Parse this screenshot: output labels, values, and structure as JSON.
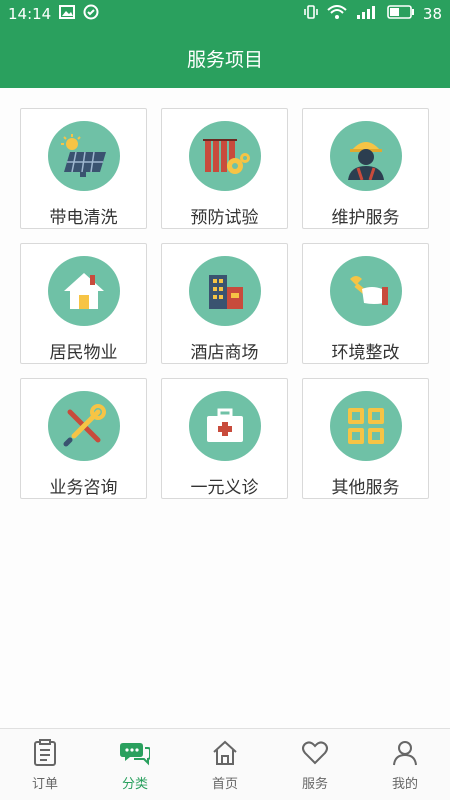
{
  "status_bar": {
    "time": "14:14",
    "battery": "38"
  },
  "header": {
    "title": "服务项目"
  },
  "services": [
    {
      "label": "带电清洗",
      "icon": "solar-panel-icon"
    },
    {
      "label": "预防试验",
      "icon": "factory-gear-icon"
    },
    {
      "label": "维护服务",
      "icon": "worker-icon"
    },
    {
      "label": "居民物业",
      "icon": "house-icon"
    },
    {
      "label": "酒店商场",
      "icon": "buildings-icon"
    },
    {
      "label": "环境整改",
      "icon": "hand-wrench-icon"
    },
    {
      "label": "业务咨询",
      "icon": "tools-icon"
    },
    {
      "label": "一元义诊",
      "icon": "medical-kit-icon"
    },
    {
      "label": "其他服务",
      "icon": "grid-icon"
    }
  ],
  "tabbar": [
    {
      "label": "订单",
      "icon": "order-icon"
    },
    {
      "label": "分类",
      "icon": "category-chat-icon",
      "active": true
    },
    {
      "label": "首页",
      "icon": "home-icon"
    },
    {
      "label": "服务",
      "icon": "heart-icon"
    },
    {
      "label": "我的",
      "icon": "user-icon"
    }
  ],
  "colors": {
    "primary": "#2aa05e",
    "icon_circle": "#6fc1a6"
  }
}
